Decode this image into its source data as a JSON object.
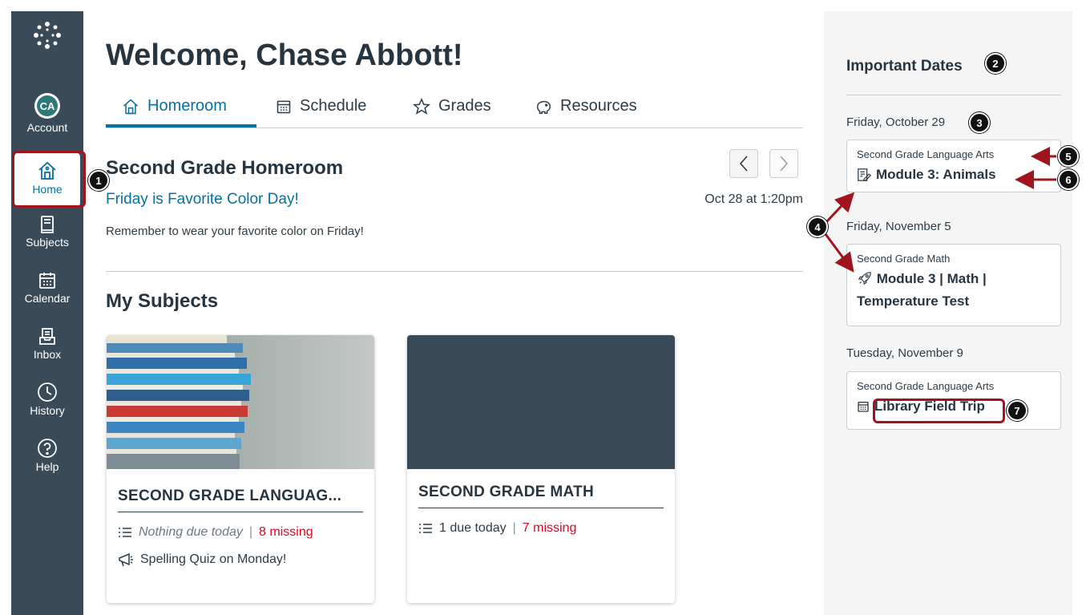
{
  "nav": {
    "account_initials": "CA",
    "account": "Account",
    "home": "Home",
    "subjects": "Subjects",
    "calendar": "Calendar",
    "inbox": "Inbox",
    "history": "History",
    "help": "Help"
  },
  "page_title": "Welcome, Chase Abbott!",
  "tabs": [
    {
      "label": "Homeroom",
      "icon": "home-icon"
    },
    {
      "label": "Schedule",
      "icon": "calendar-icon"
    },
    {
      "label": "Grades",
      "icon": "star-icon"
    },
    {
      "label": "Resources",
      "icon": "piggy-bank-icon"
    }
  ],
  "homeroom": {
    "title": "Second Grade Homeroom",
    "announcement_title": "Friday is Favorite Color Day!",
    "announcement_date": "Oct 28 at 1:20pm",
    "announcement_body": "Remember to wear your favorite color on Friday!"
  },
  "subjects_title": "My Subjects",
  "cards": [
    {
      "name": "SECOND GRADE LANGUAG...",
      "due": "Nothing due today",
      "missing": "8 missing",
      "announcement": "Spelling Quiz on Monday!"
    },
    {
      "name": "SECOND GRADE MATH",
      "due": "1 due today",
      "missing": "7 missing"
    }
  ],
  "sidebar": {
    "title": "Important Dates",
    "groups": [
      {
        "date": "Friday, October 29",
        "course": "Second Grade Language Arts",
        "item": "Module 3: Animals",
        "icon": "assignment-icon"
      },
      {
        "date": "Friday, November 5",
        "course": "Second Grade Math",
        "item": "Module 3 | Math | Temperature Test",
        "icon": "rocket-icon"
      },
      {
        "date": "Tuesday, November 9",
        "course": "Second Grade Language Arts",
        "item": "Library Field Trip",
        "icon": "calendar-icon"
      }
    ]
  },
  "callouts": [
    "1",
    "2",
    "3",
    "4",
    "5",
    "6",
    "7"
  ],
  "colors": {
    "nav_bg": "#394b58",
    "accent": "#0770a3",
    "missing": "#e0061f",
    "callout_outline": "#a0141e"
  }
}
